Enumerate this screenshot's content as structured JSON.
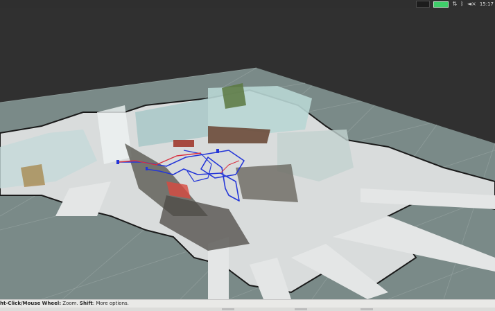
{
  "system_panel": {
    "clock": "15:17",
    "icons": [
      "network-icon",
      "battery-icon",
      "transfer-arrows-icon",
      "bluetooth-icon",
      "volume-icon"
    ]
  },
  "viewport": {
    "colors": {
      "background": "#303030",
      "ground_grid": "#7a8a88",
      "grid_lines": "#8e9c9a",
      "floor": "#d9dcdc",
      "walls": "#a8c8c8",
      "trajectory": "#2436d8",
      "trajectory_highlight": "#d83040"
    }
  },
  "status": {
    "bold_1": "ht-Click/Mouse Wheel:",
    "text_1": " Zoom. ",
    "bold_2": "Shift",
    "text_2": ": More options."
  }
}
